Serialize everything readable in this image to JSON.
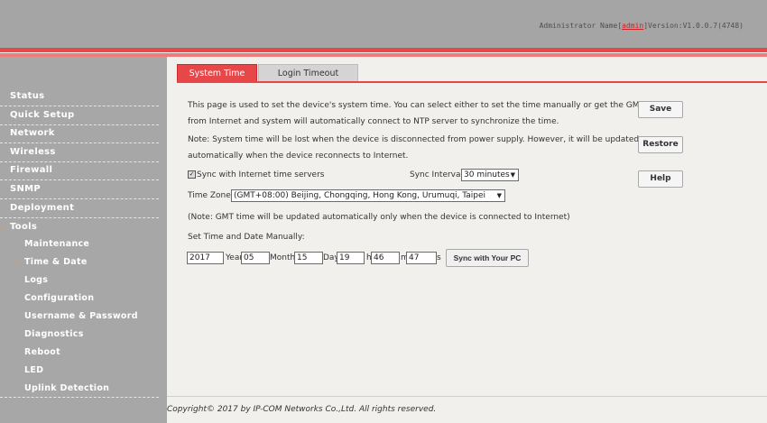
{
  "header": {
    "admin_prefix": "Administrator Name[",
    "admin_name": "admin",
    "version_text": "]Version:V1.0.0.7(4748)"
  },
  "sidebar": {
    "items": [
      {
        "label": "Status"
      },
      {
        "label": "Quick Setup"
      },
      {
        "label": "Network"
      },
      {
        "label": "Wireless"
      },
      {
        "label": "Firewall"
      },
      {
        "label": "SNMP"
      },
      {
        "label": "Deployment"
      },
      {
        "label": "Tools"
      }
    ],
    "tools_sub": [
      {
        "label": "Maintenance"
      },
      {
        "label": "Time & Date"
      },
      {
        "label": "Logs"
      },
      {
        "label": "Configuration"
      },
      {
        "label": "Username & Password"
      },
      {
        "label": "Diagnostics"
      },
      {
        "label": "Reboot"
      },
      {
        "label": "LED"
      },
      {
        "label": "Uplink Detection"
      }
    ],
    "active_arrow": "▸"
  },
  "tabs": [
    {
      "label": "System Time"
    },
    {
      "label": "Login Timeout"
    }
  ],
  "content": {
    "desc_line1": "This page is used to set the device's system time. You can select either to set the time manually or get the GMT time",
    "desc_line2": "from Internet and system will automatically connect to NTP server to synchronize the time.",
    "desc_line3": "Note: System time will be lost when the device is disconnected from power supply. However, it will be updated",
    "desc_line4": "automatically when the device reconnects to Internet.",
    "sync_label": "Sync with Internet time servers",
    "sync_checkmark": "✓",
    "sync_interval_label": "Sync Interval:",
    "sync_interval_value": "30 minutes",
    "time_zone_label": "Time Zone:",
    "time_zone_value": "(GMT+08:00) Beijing, Chongqing, Hong Kong, Urumuqi, Taipei",
    "gmt_note": "(Note: GMT time will be updated automatically only when the device is connected to Internet)",
    "manual_label": "Set Time and Date Manually:",
    "year_value": "2017",
    "year_unit": "Year",
    "month_value": "05",
    "month_unit": "Month",
    "day_value": "15",
    "day_unit": "Day",
    "hour_value": "19",
    "hour_unit": "h",
    "minute_value": "46",
    "minute_unit": "m",
    "second_value": "47",
    "second_unit": "s",
    "sync_pc_label": "Sync with Your PC"
  },
  "buttons": {
    "save": "Save",
    "restore": "Restore",
    "help": "Help"
  },
  "footer": {
    "copyright": "Copyright© 2017 by IP-COM Networks Co.,Ltd. All rights reserved."
  },
  "icons": {
    "caret": "▼"
  },
  "colors": {
    "accent_red": "#e74749",
    "sidebar_gray": "#a6a7a6",
    "arrow_orange": "#e0a02a"
  }
}
